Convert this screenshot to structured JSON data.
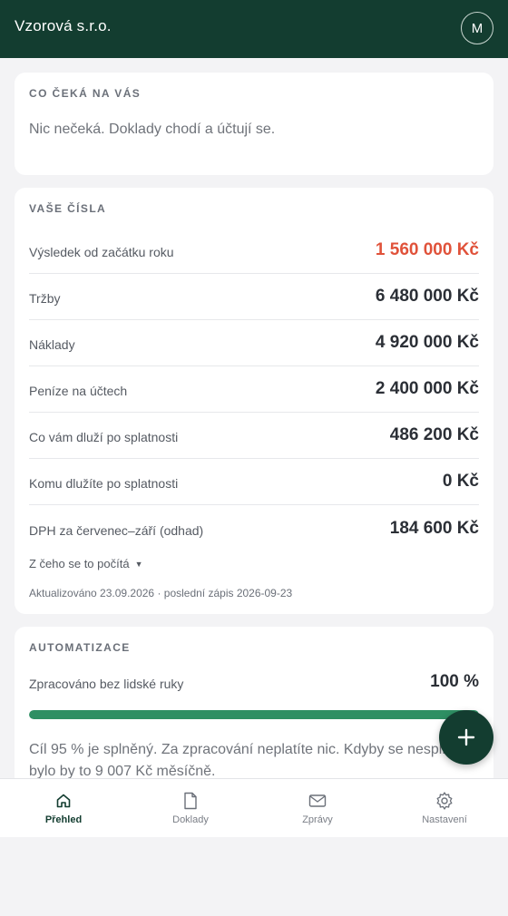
{
  "header": {
    "company_name": "Vzorová s.r.o.",
    "avatar_initial": "M"
  },
  "todo": {
    "title": "CO ČEKÁ NA VÁS",
    "text": "Nic nečeká. Doklady chodí a účtují se."
  },
  "numbers": {
    "title": "VAŠE ČÍSLA",
    "rows": [
      {
        "label": "Výsledek od začátku roku",
        "value": "1 560 000 Kč",
        "highlight": "#e0523a"
      },
      {
        "label": "Tržby",
        "value": "6 480 000 Kč"
      },
      {
        "label": "Náklady",
        "value": "4 920 000 Kč"
      },
      {
        "label": "Peníze na účtech",
        "value": "2 400 000 Kč"
      },
      {
        "label": "Co vám dluží po splatnosti",
        "value": "486 200 Kč"
      },
      {
        "label": "Komu dlužíte po splatnosti",
        "value": "0 Kč"
      },
      {
        "label": "DPH za červenec–září (odhad)",
        "value": "184 600 Kč"
      }
    ],
    "explain_link": "Z čeho se to počítá",
    "updated": "Aktualizováno 23.09.2026 · poslední zápis 2026-09-23"
  },
  "automation": {
    "title": "AUTOMATIZACE",
    "label": "Zpracováno bez lidské ruky",
    "value": "100 %",
    "progress": 1.0,
    "note": "Cíl 95 % je splněný. Za zpracování neplatíte nic. Kdyby se nesplnil, bylo by to 9 007 Kč měsíčně."
  },
  "fab": {
    "icon": "plus-icon"
  },
  "nav": {
    "items": [
      {
        "label": "Přehled",
        "icon": "home-icon",
        "active": true
      },
      {
        "label": "Doklady",
        "icon": "document-icon",
        "active": false
      },
      {
        "label": "Zprávy",
        "icon": "mail-icon",
        "active": false
      },
      {
        "label": "Nastavení",
        "icon": "gear-icon",
        "active": false
      }
    ]
  },
  "colors": {
    "brand": "#133d30",
    "progress": "#2e8f63",
    "negative": "#e0523a"
  }
}
